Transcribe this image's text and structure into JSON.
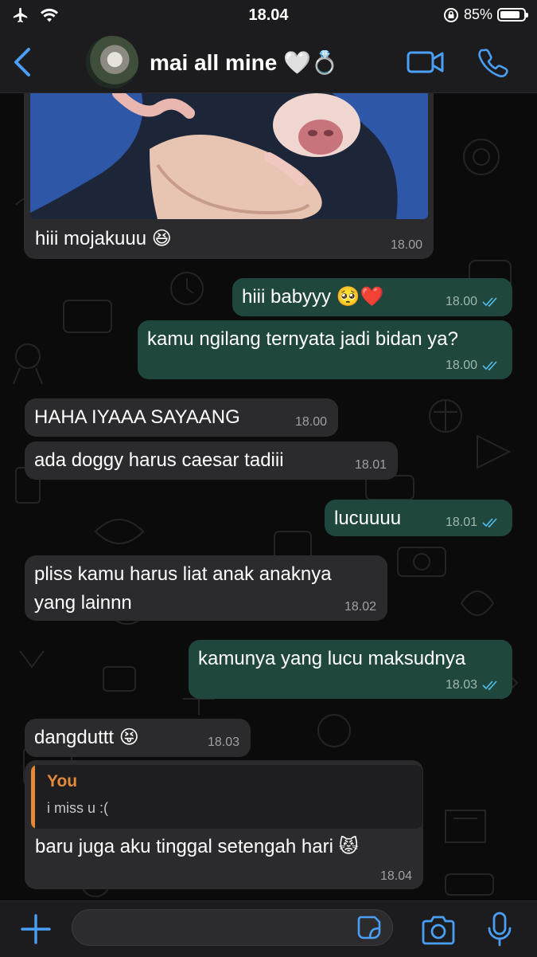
{
  "status_bar": {
    "time": "18.04",
    "battery": "85%",
    "battery_level": 0.85
  },
  "header": {
    "contact_name": "mai all mine 🤍💍"
  },
  "messages": [
    {
      "text": "hiii mojakuuu 😆",
      "time": "18.00",
      "direction": "in",
      "has_photo": true
    },
    {
      "text": "hiii babyyy 🥺❤️",
      "time": "18.00",
      "direction": "out",
      "read": true
    },
    {
      "text": "kamu ngilang ternyata jadi bidan ya?",
      "time": "18.00",
      "direction": "out",
      "read": true
    },
    {
      "text": "HAHA IYAAA SAYAANG",
      "time": "18.00",
      "direction": "in"
    },
    {
      "text": "ada doggy harus caesar tadiii",
      "time": "18.01",
      "direction": "in"
    },
    {
      "text": "lucuuuu",
      "time": "18.01",
      "direction": "out",
      "read": true
    },
    {
      "text_line1": "pliss kamu harus liat anak anaknya",
      "text_line2": "yang lainnn",
      "time": "18.02",
      "direction": "in"
    },
    {
      "text": "kamunya yang lucu maksudnya",
      "time": "18.03",
      "direction": "out",
      "read": true
    },
    {
      "text": "dangduttt 😝",
      "time": "18.03",
      "direction": "in"
    },
    {
      "reply_to_name": "You",
      "reply_to_text": "i miss u :(",
      "text": "baru juga aku tinggal setengah hari 😾",
      "time": "18.04",
      "direction": "in"
    }
  ],
  "composer": {
    "placeholder": ""
  },
  "colors": {
    "accent": "#4a9ff5",
    "incoming_bubble": "#2b2b2d",
    "outgoing_bubble": "#20473e",
    "reply_accent": "#e58a3a",
    "read_ticks": "#53bdeb"
  },
  "icons": [
    "airplane-icon",
    "wifi-icon",
    "lock-rotation-icon",
    "battery-icon",
    "back-chevron-icon",
    "video-call-icon",
    "phone-call-icon",
    "plus-icon",
    "sticker-icon",
    "camera-icon",
    "microphone-icon"
  ]
}
